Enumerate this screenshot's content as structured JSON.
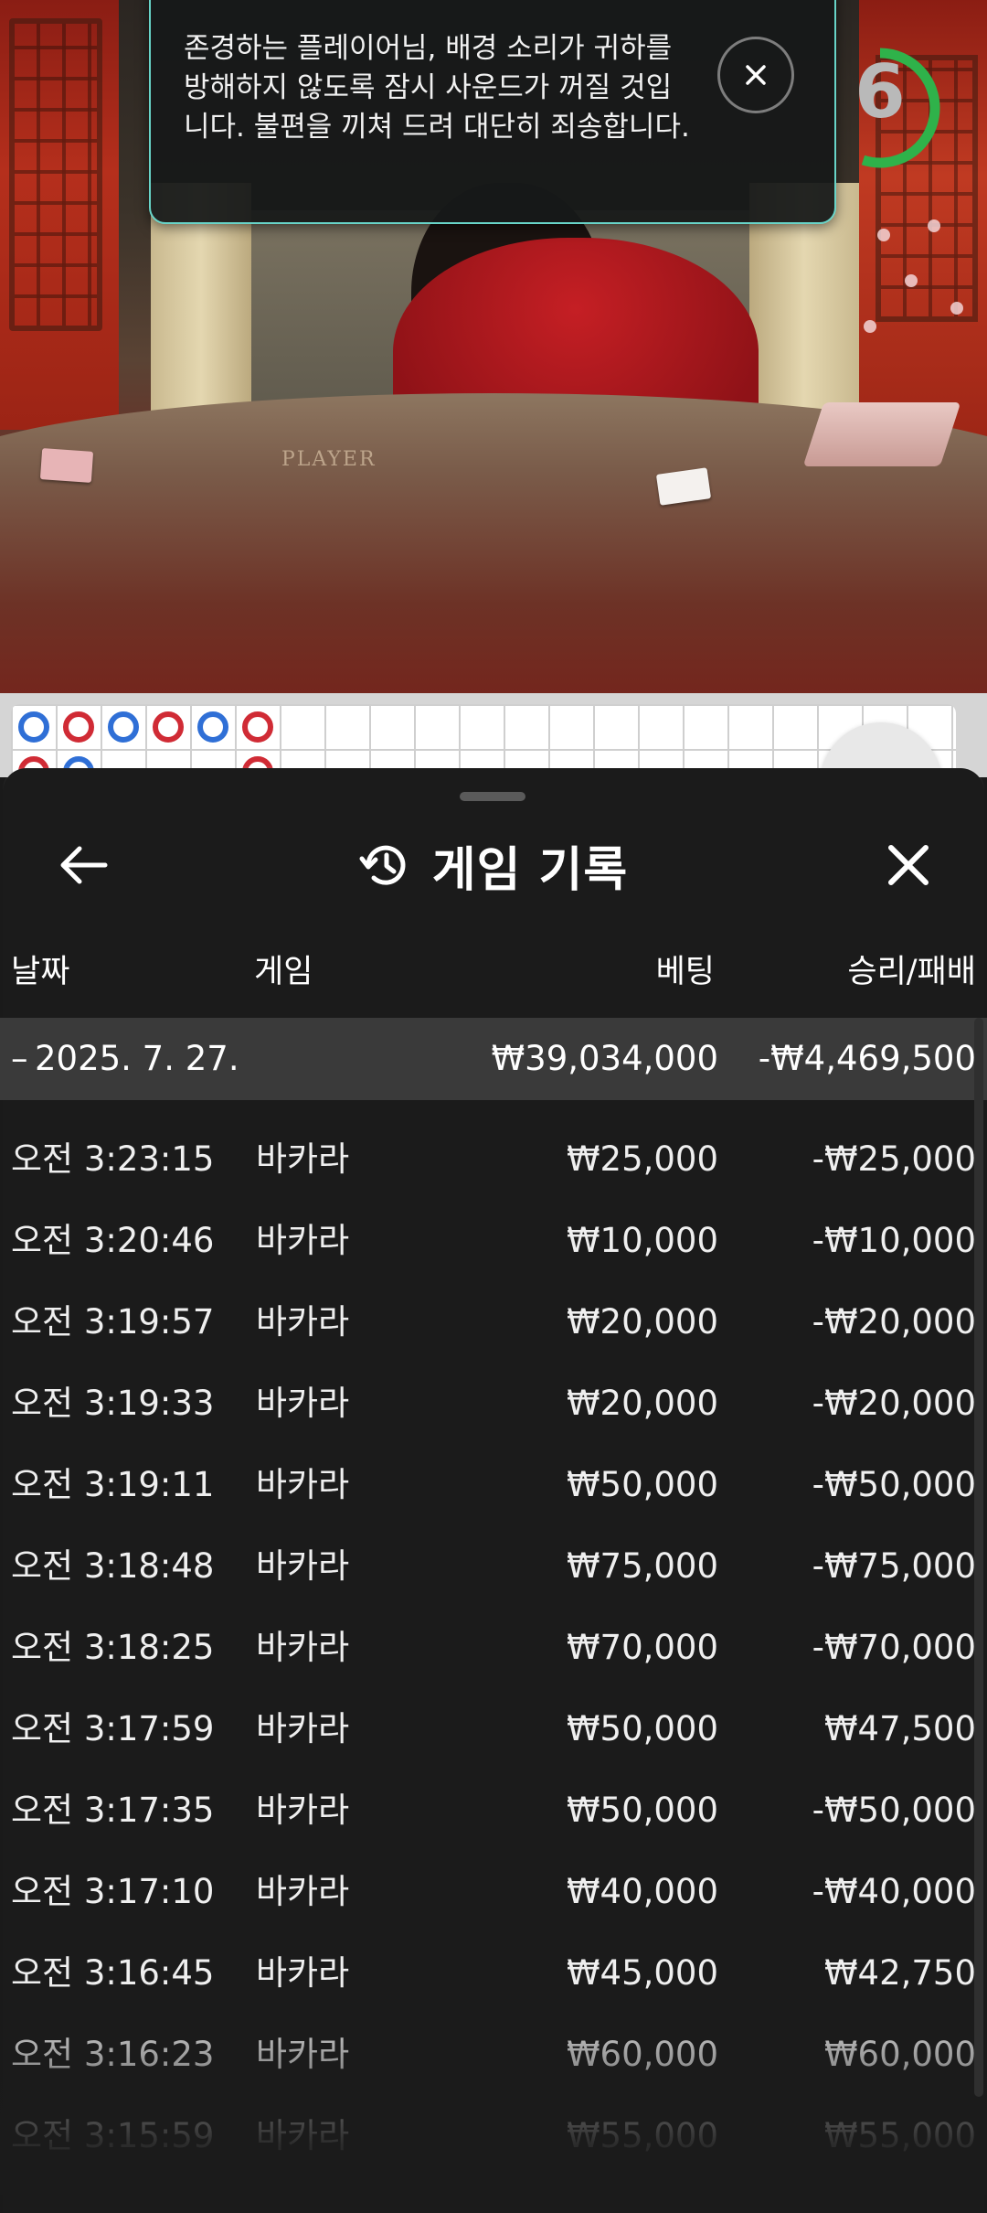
{
  "toast": {
    "message": "존경하는 플레이어님, 배경 소리가 귀하를 방해하지 않도록 잠시 사운드가 꺼질 것입니다. 불편을 끼쳐 드려 대단히 죄송합니다.",
    "close_icon": "close-icon"
  },
  "countdown": {
    "value": "6",
    "progress": 0.55,
    "color": "#2fb24a"
  },
  "table_labels": {
    "player": "PLAYER"
  },
  "roadmap": {
    "beads": [
      "blue",
      "red",
      "blue",
      "red",
      "blue",
      "red"
    ],
    "second_row": [
      "red",
      "blue",
      "",
      "",
      "",
      "red"
    ]
  },
  "history": {
    "title": "게임 기록",
    "title_icon": "history-icon",
    "back_icon": "back-arrow-icon",
    "close_icon": "close-icon",
    "columns": {
      "date": "날짜",
      "game": "게임",
      "bet": "베팅",
      "result": "승리/패배"
    },
    "date_group": {
      "toggle": "–",
      "date": "2025. 7. 27.",
      "bet_total": "₩39,034,000",
      "result_total": "-₩4,469,500"
    },
    "rows": [
      {
        "time": "오전 3:23:15",
        "game": "바카라",
        "bet": "₩25,000",
        "result": "-₩25,000"
      },
      {
        "time": "오전 3:20:46",
        "game": "바카라",
        "bet": "₩10,000",
        "result": "-₩10,000"
      },
      {
        "time": "오전 3:19:57",
        "game": "바카라",
        "bet": "₩20,000",
        "result": "-₩20,000"
      },
      {
        "time": "오전 3:19:33",
        "game": "바카라",
        "bet": "₩20,000",
        "result": "-₩20,000"
      },
      {
        "time": "오전 3:19:11",
        "game": "바카라",
        "bet": "₩50,000",
        "result": "-₩50,000"
      },
      {
        "time": "오전 3:18:48",
        "game": "바카라",
        "bet": "₩75,000",
        "result": "-₩75,000"
      },
      {
        "time": "오전 3:18:25",
        "game": "바카라",
        "bet": "₩70,000",
        "result": "-₩70,000"
      },
      {
        "time": "오전 3:17:59",
        "game": "바카라",
        "bet": "₩50,000",
        "result": "₩47,500"
      },
      {
        "time": "오전 3:17:35",
        "game": "바카라",
        "bet": "₩50,000",
        "result": "-₩50,000"
      },
      {
        "time": "오전 3:17:10",
        "game": "바카라",
        "bet": "₩40,000",
        "result": "-₩40,000"
      },
      {
        "time": "오전 3:16:45",
        "game": "바카라",
        "bet": "₩45,000",
        "result": "₩42,750"
      },
      {
        "time": "오전 3:16:23",
        "game": "바카라",
        "bet": "₩60,000",
        "result": "₩60,000"
      },
      {
        "time": "오전 3:15:59",
        "game": "바카라",
        "bet": "₩55,000",
        "result": "₩55,000"
      }
    ]
  },
  "colors": {
    "bead_blue": "#2f6fd6",
    "bead_red": "#d02b35",
    "toast_border": "#68d4c8",
    "sheet_bg": "#1b1b1b"
  }
}
